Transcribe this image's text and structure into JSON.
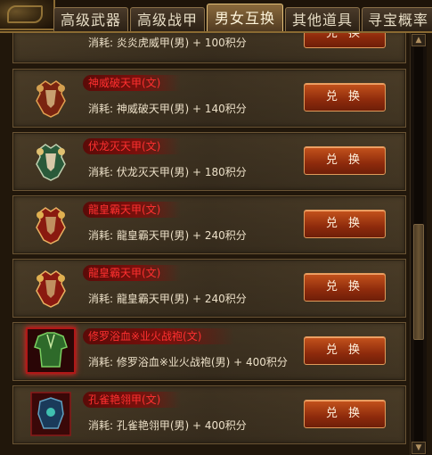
{
  "tabs": [
    "高级武器",
    "高级战甲",
    "男女互换",
    "其他道具",
    "寻宝概率"
  ],
  "active_tab": "男女互换",
  "partial_row": {
    "cost": "消耗: 炎炎虎威甲(男) + 100积分",
    "button": "兑 换"
  },
  "items": [
    {
      "name": "神威破天甲(文)",
      "cost": "消耗: 神威破天甲(男) + 140积分",
      "button": "兑 换",
      "icon": "armor-icon"
    },
    {
      "name": "伏龙灭天甲(文)",
      "cost": "消耗: 伏龙灭天甲(男) + 180积分",
      "button": "兑 换",
      "icon": "armor-icon"
    },
    {
      "name": "龍皇霸天甲(文)",
      "cost": "消耗: 龍皇霸天甲(男) + 240积分",
      "button": "兑 换",
      "icon": "armor-icon"
    },
    {
      "name": "龍皇霸天甲(文)",
      "cost": "消耗: 龍皇霸天甲(男) + 240积分",
      "button": "兑 换",
      "icon": "armor-icon"
    },
    {
      "name": "修罗浴血※业火战袍(文)",
      "cost": "消耗: 修罗浴血※业火战袍(男) + 400积分",
      "button": "兑 换",
      "icon": "robe-icon"
    },
    {
      "name": "孔雀艳翎甲(文)",
      "cost": "消耗: 孔雀艳翎甲(男) + 400积分",
      "button": "兑 换",
      "icon": "peacock-armor-icon"
    }
  ],
  "scrollbar": {
    "up": "▲",
    "down": "▼"
  },
  "colors": {
    "item_name": "#ff3030",
    "button": "#b3421a",
    "frame": "#8a6a32"
  }
}
